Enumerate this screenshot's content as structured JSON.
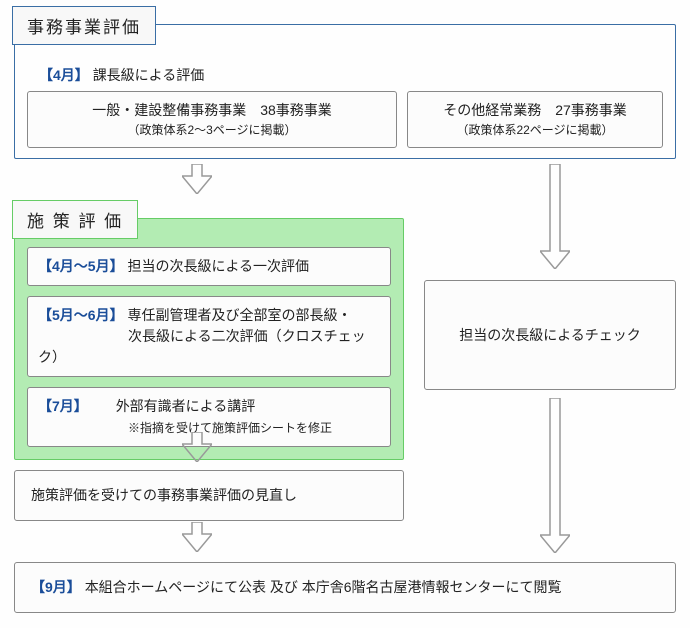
{
  "section1": {
    "title": "事務事業評価",
    "header_tag": "【4月】",
    "header_text": "課長級による評価",
    "leftBox": {
      "line1": "一般・建設整備事務事業　38事務事業",
      "line2": "（政策体系2～3ページに掲載）"
    },
    "rightBox": {
      "line1": "その他経常業務　27事務事業",
      "line2": "（政策体系22ページに掲載）"
    }
  },
  "section2": {
    "title": "施 策 評 価",
    "step1_tag": "【4月～5月】",
    "step1_text": "担当の次長級による一次評価",
    "step2_tag": "【5月～6月】",
    "step2_text1": "専任副管理者及び全部室の部長級・",
    "step2_text2": "次長級による二次評価（クロスチェック）",
    "step3_tag": "【7月】",
    "step3_text": "外部有識者による講評",
    "step3_note": "※指摘を受けて施策評価シートを修正"
  },
  "rightCheck": "担当の次長級によるチェック",
  "review": "施策評価を受けての事務事業評価の見直し",
  "final_tag": "【9月】",
  "final_text": "本組合ホームページにて公表 及び 本庁舎6階名古屋港情報センターにて閲覧"
}
